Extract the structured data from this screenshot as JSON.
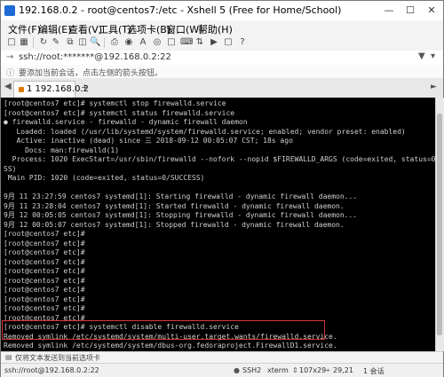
{
  "window": {
    "title": "192.168.0.2 - root@centos7:/etc - Xshell 5 (Free for Home/School)"
  },
  "menu": [
    "文件(F)",
    "编辑(E)",
    "查看(V)",
    "工具(T)",
    "选项卡(B)",
    "窗口(W)",
    "帮助(H)"
  ],
  "address": {
    "value": "ssh://root:*******@192.168.0.2:22"
  },
  "hint": {
    "text": "要添加当前会话，点击左侧的箭头按钮。"
  },
  "tabs": [
    {
      "label": "1 192.168.0.2",
      "active": true
    }
  ],
  "terminal": {
    "lines": [
      "[root@centos7 etc]# systemctl stop firewalld.service",
      "[root@centos7 etc]# systemctl status firewalld.service",
      "● firewalld.service - firewalld - dynamic firewall daemon",
      "   Loaded: loaded (/usr/lib/systemd/system/firewalld.service; enabled; vendor preset: enabled)",
      "   Active: inactive (dead) since 三 2018-09-12 00:05:07 CST; 18s ago",
      "     Docs: man:firewalld(1)",
      "  Process: 1020 ExecStart=/usr/sbin/firewalld --nofork --nopid $FIREWALLD_ARGS (code=exited, status=0/SUCCE",
      "SS)",
      " Main PID: 1020 (code=exited, status=0/SUCCESS)",
      "",
      "9月 11 23:27:59 centos7 systemd[1]: Starting firewalld - dynamic firewall daemon...",
      "9月 11 23:28:04 centos7 systemd[1]: Started firewalld - dynamic firewall daemon.",
      "9月 12 00:05:05 centos7 systemd[1]: Stopping firewalld - dynamic firewall daemon...",
      "9月 12 00:05:07 centos7 systemd[1]: Stopped firewalld - dynamic firewall daemon.",
      "[root@centos7 etc]#",
      "[root@centos7 etc]#",
      "[root@centos7 etc]#",
      "[root@centos7 etc]#",
      "[root@centos7 etc]#",
      "[root@centos7 etc]#",
      "[root@centos7 etc]#",
      "[root@centos7 etc]#",
      "[root@centos7 etc]#",
      "[root@centos7 etc]#",
      "[root@centos7 etc]# systemctl disable firewalld.service",
      "Removed symlink /etc/systemd/system/multi-user.target.wants/firewalld.service.",
      "Removed symlink /etc/systemd/system/dbus-org.fedoraproject.FirewallD1.service.",
      "[root@centos7 etc]# "
    ]
  },
  "compose": {
    "text": "仅将文本发送到当前选项卡"
  },
  "status": {
    "connection": "ssh://root@192.168.0.2:22",
    "protocol": "SSH2",
    "term": "xterm",
    "size": "107x29",
    "cursor": "29,21",
    "sessions": "1 会话"
  },
  "colors": {
    "terminal_bg": "#000000",
    "terminal_fg": "#cfcfcf",
    "cursor": "#33dd33",
    "highlight_border": "#d23a3a"
  }
}
